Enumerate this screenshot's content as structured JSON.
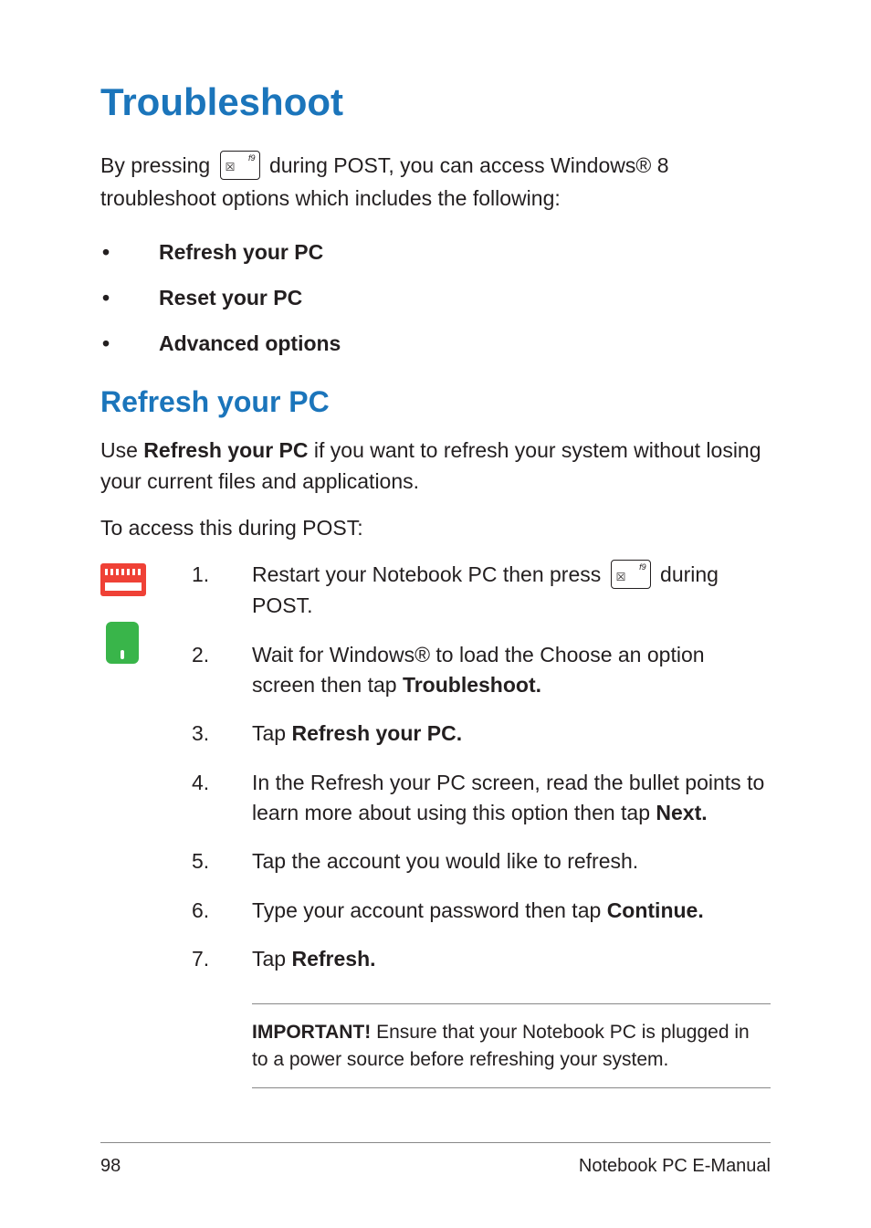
{
  "title": "Troubleshoot",
  "intro_pre": "By pressing ",
  "intro_post": " during POST, you can access Windows® 8 troubleshoot options which includes the following:",
  "key_fn": "f9",
  "key_glyph": "☒",
  "bullets": [
    "Refresh your PC",
    "Reset your PC",
    "Advanced options"
  ],
  "section_title": "Refresh your PC",
  "section_para_pre": "Use ",
  "section_para_bold": "Refresh your PC",
  "section_para_post": " if you want to refresh your system without losing your current files and applications.",
  "access_line": "To access this during POST:",
  "steps": [
    {
      "num": "1.",
      "pre": "Restart your Notebook PC then press ",
      "has_key": true,
      "post": " during POST."
    },
    {
      "num": "2.",
      "pre": "Wait for Windows® to load the Choose an option screen then tap ",
      "bold": "Troubleshoot.",
      "post": ""
    },
    {
      "num": "3.",
      "pre": "Tap ",
      "bold": "Refresh your PC.",
      "post": ""
    },
    {
      "num": "4.",
      "pre": "In the Refresh your PC screen, read the bullet points to learn more about using this option then tap ",
      "bold": "Next.",
      "post": ""
    },
    {
      "num": "5.",
      "pre": "Tap the account you would like to refresh.",
      "bold": "",
      "post": ""
    },
    {
      "num": "6.",
      "pre": "Type your account password then tap ",
      "bold": "Continue.",
      "post": ""
    },
    {
      "num": "7.",
      "pre": "Tap ",
      "bold": "Refresh.",
      "post": ""
    }
  ],
  "important_label": "IMPORTANT!",
  "important_text": " Ensure that your Notebook PC is plugged in to a power source before refreshing your system.",
  "footer_page": "98",
  "footer_title": "Notebook PC E-Manual"
}
